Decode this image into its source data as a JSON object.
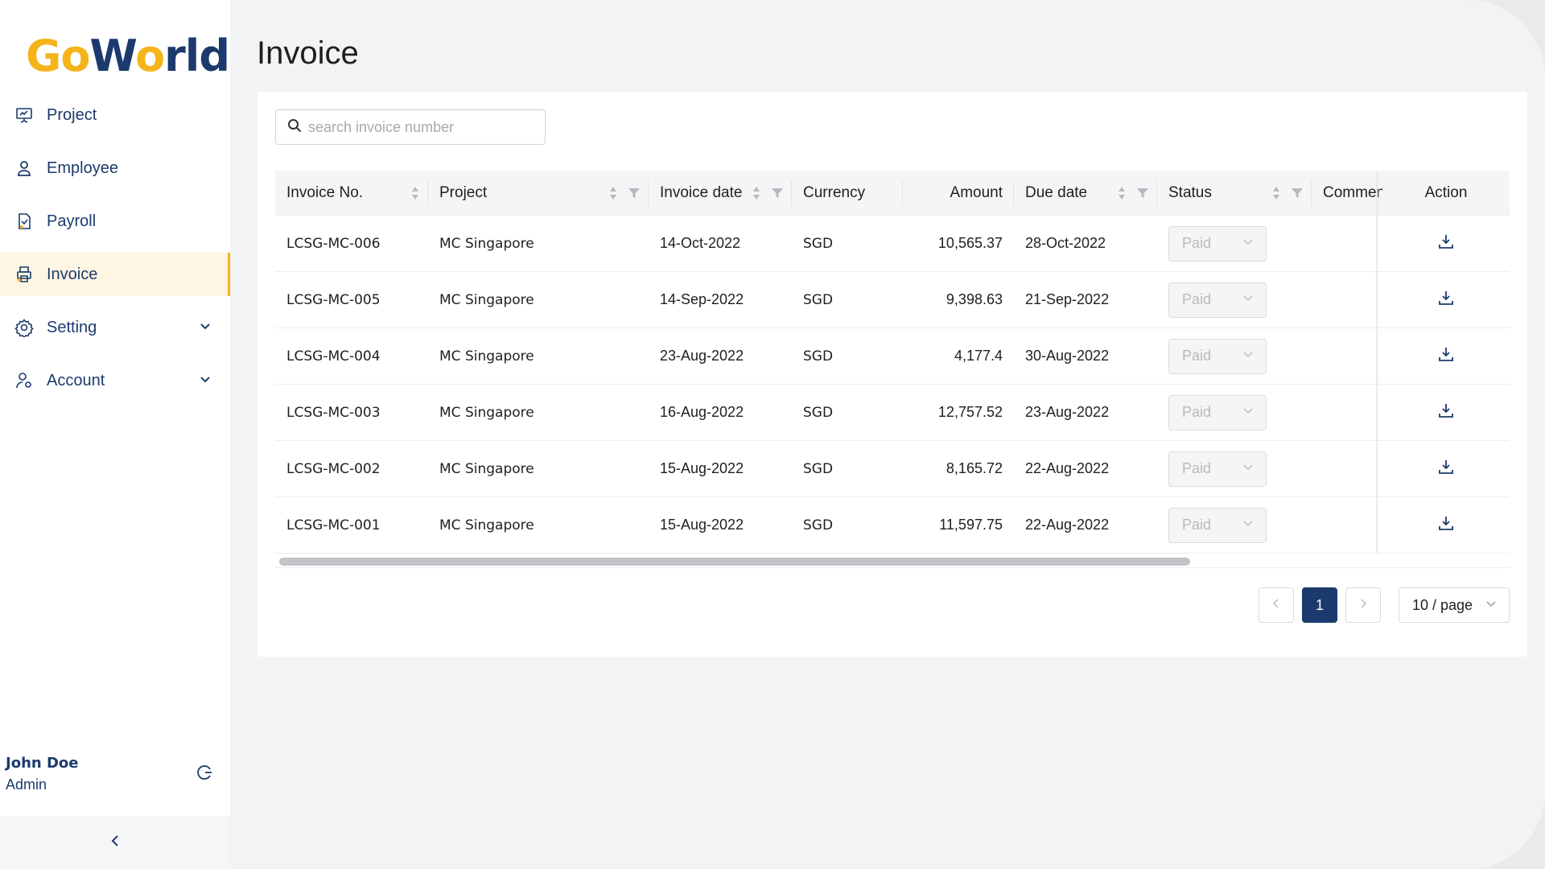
{
  "brand": {
    "logo_go": "Go",
    "logo_world": "W",
    "logo_o": "o",
    "logo_rld": "rld"
  },
  "sidebar": {
    "items": [
      {
        "label": "Project",
        "icon": "presentation-icon"
      },
      {
        "label": "Employee",
        "icon": "user-icon"
      },
      {
        "label": "Payroll",
        "icon": "payroll-document-icon"
      },
      {
        "label": "Invoice",
        "icon": "invoice-printer-icon",
        "active": true
      },
      {
        "label": "Setting",
        "icon": "gear-icon",
        "expandable": true
      },
      {
        "label": "Account",
        "icon": "account-gear-icon",
        "expandable": true
      }
    ],
    "user": {
      "name": "John Doe",
      "role": "Admin"
    },
    "collapse_icon": "chevron-left-icon"
  },
  "page": {
    "title": "Invoice"
  },
  "search": {
    "placeholder": "search invoice number",
    "value": ""
  },
  "table": {
    "columns": [
      "Invoice No.",
      "Project",
      "Invoice date",
      "Currency",
      "Amount",
      "Due date",
      "Status",
      "Comment",
      "Action"
    ],
    "rows": [
      {
        "invoice_no": "LCSG-MC-006",
        "project": "MC Singapore",
        "invoice_date": "14-Oct-2022",
        "currency": "SGD",
        "amount": "10,565.37",
        "due_date": "28-Oct-2022",
        "status": "Paid"
      },
      {
        "invoice_no": "LCSG-MC-005",
        "project": "MC Singapore",
        "invoice_date": "14-Sep-2022",
        "currency": "SGD",
        "amount": "9,398.63",
        "due_date": "21-Sep-2022",
        "status": "Paid"
      },
      {
        "invoice_no": "LCSG-MC-004",
        "project": "MC Singapore",
        "invoice_date": "23-Aug-2022",
        "currency": "SGD",
        "amount": "4,177.4",
        "due_date": "30-Aug-2022",
        "status": "Paid"
      },
      {
        "invoice_no": "LCSG-MC-003",
        "project": "MC Singapore",
        "invoice_date": "16-Aug-2022",
        "currency": "SGD",
        "amount": "12,757.52",
        "due_date": "23-Aug-2022",
        "status": "Paid"
      },
      {
        "invoice_no": "LCSG-MC-002",
        "project": "MC Singapore",
        "invoice_date": "15-Aug-2022",
        "currency": "SGD",
        "amount": "8,165.72",
        "due_date": "22-Aug-2022",
        "status": "Paid"
      },
      {
        "invoice_no": "LCSG-MC-001",
        "project": "MC Singapore",
        "invoice_date": "15-Aug-2022",
        "currency": "SGD",
        "amount": "11,597.75",
        "due_date": "22-Aug-2022",
        "status": "Paid"
      }
    ]
  },
  "pagination": {
    "prev": "<",
    "current": "1",
    "next": ">",
    "page_size": "10 / page"
  },
  "colors": {
    "brand_blue": "#1c3a6e",
    "brand_yellow": "#f4b41a",
    "active_bg": "#fdf6e3"
  }
}
